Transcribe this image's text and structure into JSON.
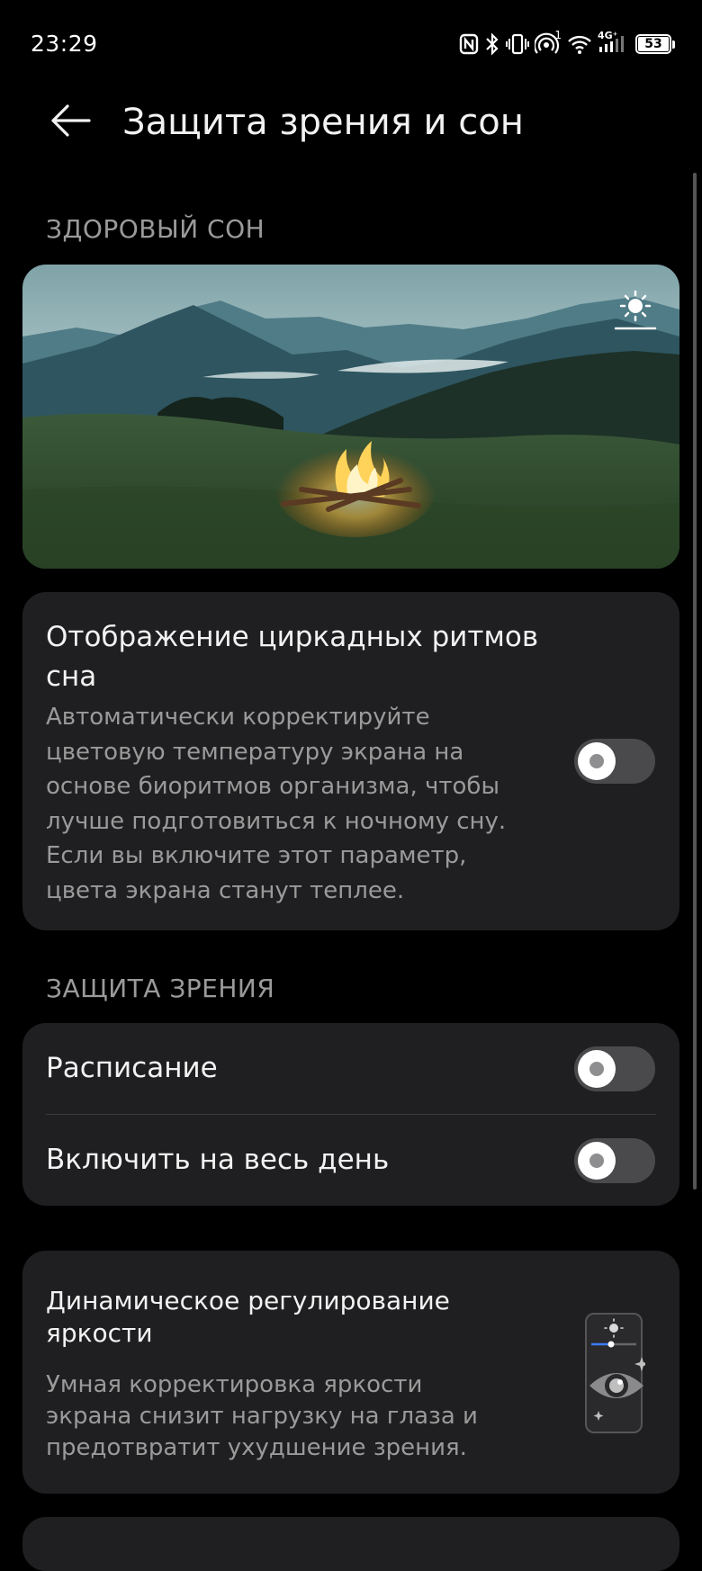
{
  "status_bar": {
    "time": "23:29",
    "icons": [
      "nfc-icon",
      "bluetooth-icon",
      "vibrate-icon",
      "hotspot-icon",
      "wifi-icon",
      "signal-icon"
    ],
    "hotspot_badge": "1",
    "network_type": "4G⁺",
    "battery_level": "53"
  },
  "header": {
    "title": "Защита зрения и сон",
    "back_icon": "arrow-left-icon"
  },
  "sections": {
    "healthy_sleep": "ЗДОРОВЫЙ СОН",
    "eye_protection": "ЗАЩИТА ЗРЕНИЯ"
  },
  "hero": {
    "toggle_icon": "sun-icon"
  },
  "circadian": {
    "title_line1": "Отображение циркадных ритмов",
    "title_line2": "сна",
    "desc_lines": [
      "Автоматически корректируйте",
      "цветовую температуру экрана на",
      "основе биоритмов организма, чтобы",
      "лучше подготовиться к ночному сну.",
      "Если вы включите этот параметр,",
      "цвета экрана станут теплее."
    ],
    "enabled": false
  },
  "eye_protection": {
    "schedule_label": "Расписание",
    "schedule_enabled": false,
    "all_day_label": "Включить на весь день",
    "all_day_enabled": false
  },
  "dynamic_brightness": {
    "title_line1": "Динамическое регулирование",
    "title_line2": "яркости",
    "desc_lines": [
      "Умная корректировка яркости",
      "экрана снизит нагрузку на глаза и",
      "предотвратит ухудшение зрения."
    ],
    "illustration_icon": "eye-brightness-icon"
  },
  "colors": {
    "background": "#000000",
    "card": "#1f1f21",
    "secondary_text": "#9a9a9a",
    "toggle_off": "#4a4a4c",
    "accent_blue": "#3a7bff"
  }
}
